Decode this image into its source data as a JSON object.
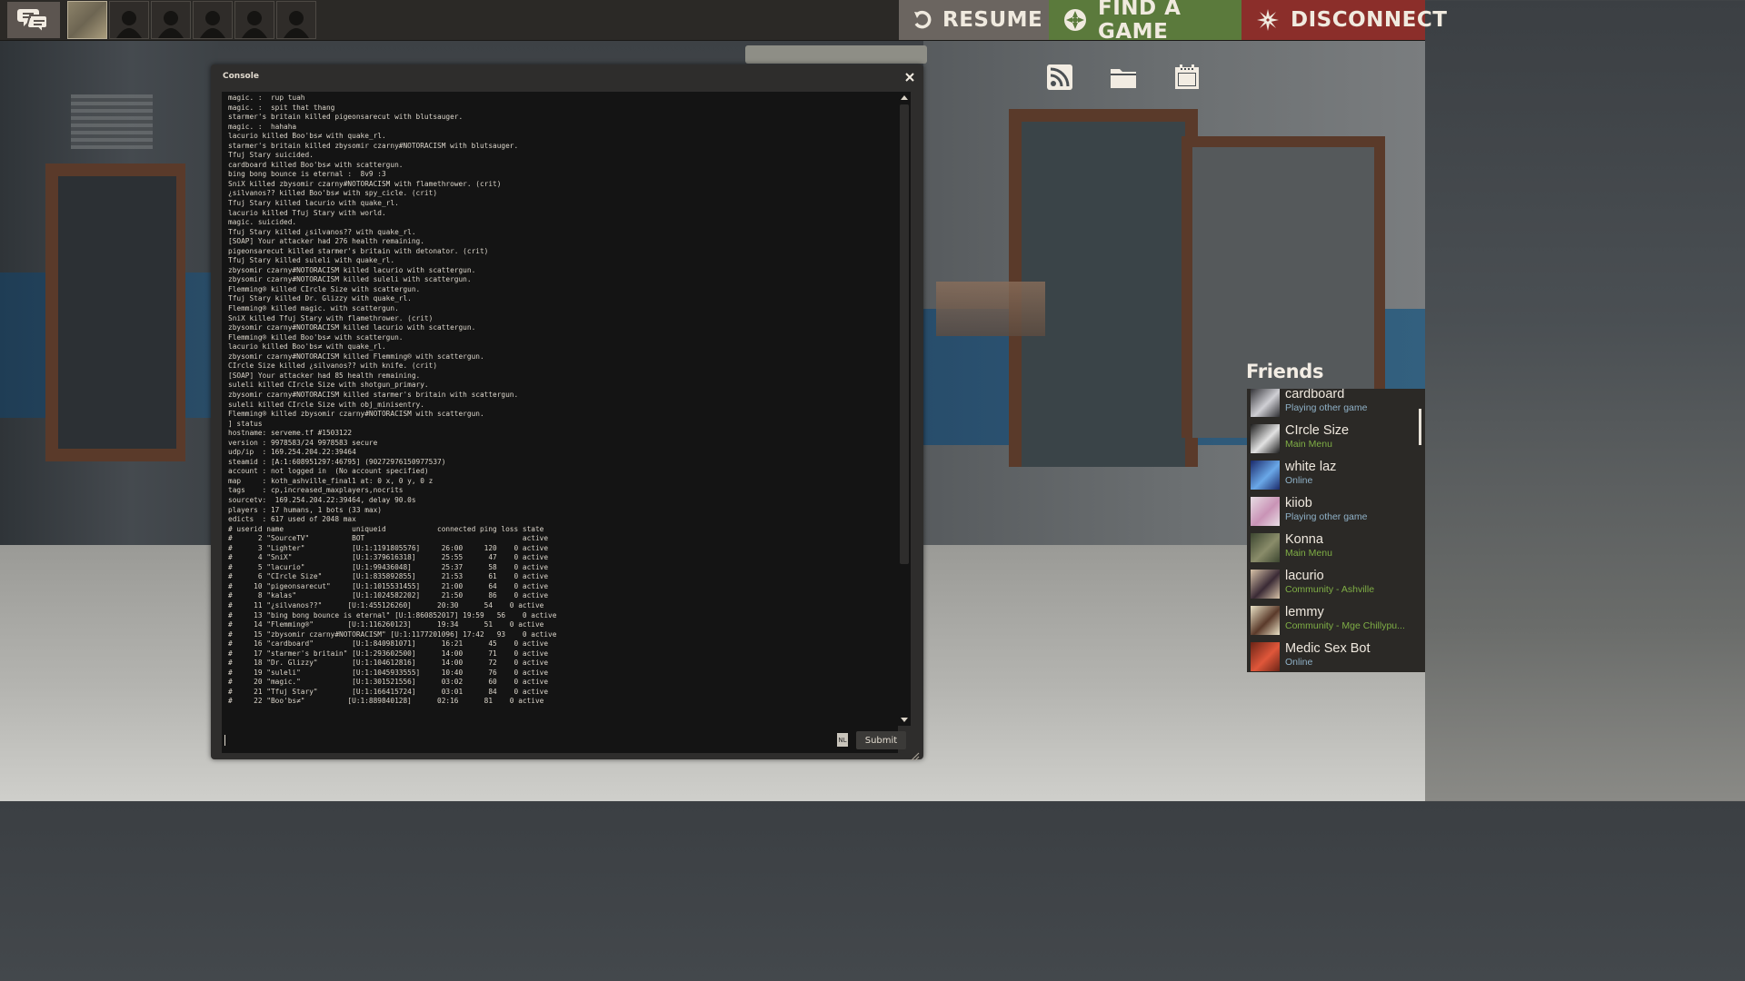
{
  "topbar": {
    "resume_label": "RESUME",
    "find_label": "FIND A GAME",
    "disconnect_label": "DISCONNECT",
    "icons": [
      "chat-icon",
      "resume-icon",
      "find-game-icon",
      "disconnect-icon"
    ]
  },
  "right_icons": [
    "rss-icon",
    "folder-icon",
    "calendar-icon"
  ],
  "console": {
    "title": "Console",
    "input_value": "",
    "nl_label": "NL",
    "submit_label": "Submit",
    "lines": [
      "magic. :  rup tuah",
      "magic. :  spit that thang",
      "starmer's britain killed pigeonsarecut with blutsauger.",
      "magic. :  hahaha",
      "lacurio killed Boo'bs≠ with quake_rl.",
      "starmer's britain killed zbysomir czarny#NOTORACISM with blutsauger.",
      "Tfuj Stary suicided.",
      "cardboard killed Boo'bs≠ with scattergun.",
      "bing bong bounce is eternal :  8v9 :3",
      "SniX killed zbysomir czarny#NOTORACISM with flamethrower. (crit)",
      "¿silvanos?? killed Boo'bs≠ with spy_cicle. (crit)",
      "Tfuj Stary killed lacurio with quake_rl.",
      "lacurio killed Tfuj Stary with world.",
      "magic. suicided.",
      "Tfuj Stary killed ¿silvanos?? with quake_rl.",
      "[SOAP] Your attacker had 276 health remaining.",
      "pigeonsarecut killed starmer's britain with detonator. (crit)",
      "Tfuj Stary killed suleli with quake_rl.",
      "zbysomir czarny#NOTORACISM killed lacurio with scattergun.",
      "zbysomir czarny#NOTORACISM killed suleli with scattergun.",
      "Flemming® killed CIrcle Size with scattergun.",
      "Tfuj Stary killed Dr. Glizzy with quake_rl.",
      "Flemming® killed magic. with scattergun.",
      "SniX killed Tfuj Stary with flamethrower. (crit)",
      "zbysomir czarny#NOTORACISM killed lacurio with scattergun.",
      "Flemming® killed Boo'bs≠ with scattergun.",
      "lacurio killed Boo'bs≠ with quake_rl.",
      "zbysomir czarny#NOTORACISM killed Flemming® with scattergun.",
      "CIrcle Size killed ¿silvanos?? with knife. (crit)",
      "[SOAP] Your attacker had 85 health remaining.",
      "suleli killed CIrcle Size with shotgun_primary.",
      "zbysomir czarny#NOTORACISM killed starmer's britain with scattergun.",
      "suleli killed CIrcle Size with obj_minisentry.",
      "Flemming® killed zbysomir czarny#NOTORACISM with scattergun.",
      "] status",
      "hostname: serveme.tf #1503122",
      "version : 9978583/24 9978583 secure",
      "udp/ip  : 169.254.204.22:39464",
      "steamid : [A:1:608951297:46795] (90272976150977537)",
      "account : not logged in  (No account specified)",
      "map     : koth_ashville_final1 at: 0 x, 0 y, 0 z",
      "tags    : cp,increased_maxplayers,nocrits",
      "sourcetv:  169.254.204.22:39464, delay 90.0s",
      "players : 17 humans, 1 bots (33 max)",
      "edicts  : 617 used of 2048 max",
      "# userid name                uniqueid            connected ping loss state",
      "#      2 \"SourceTV\"          BOT                                     active",
      "#      3 \"Lighter\"           [U:1:1191805576]     26:00     120    0 active",
      "#      4 \"SniX\"              [U:1:379616318]      25:55      47    0 active",
      "#      5 \"lacurio\"           [U:1:99436048]       25:37      58    0 active",
      "#      6 \"CIrcle Size\"       [U:1:835892855]      21:53      61    0 active",
      "#     10 \"pigeonsarecut\"     [U:1:1015531455]     21:00      64    0 active",
      "#      8 \"kalas\"             [U:1:1024582202]     21:50      86    0 active",
      "#     11 \"¿silvanos??\"      [U:1:455126260]      20:30      54    0 active",
      "#     13 \"bing bong bounce is eternal\" [U:1:860852017] 19:59   56    0 active",
      "#     14 \"Flemming®\"        [U:1:116260123]      19:34      51    0 active",
      "#     15 \"zbysomir czarny#NOTORACISM\" [U:1:1177201096] 17:42   93    0 active",
      "#     16 \"cardboard\"         [U:1:840981071]      16:21      45    0 active",
      "#     17 \"starmer's britain\" [U:1:293602500]      14:00      71    0 active",
      "#     18 \"Dr. Glizzy\"        [U:1:104612816]      14:00      72    0 active",
      "#     19 \"suleli\"            [U:1:1045933555]     10:40      76    0 active",
      "#     20 \"magic.\"            [U:1:301521556]      03:02      60    0 active",
      "#     21 \"Tfuj Stary\"        [U:1:166415724]      03:01      84    0 active",
      "#     22 \"Boo'bs≠\"          [U:1:889840128]      02:16      81    0 active"
    ]
  },
  "friends": {
    "title": "Friends",
    "list": [
      {
        "name": "cardboard",
        "status": "Playing other game",
        "status_color": "#8fb1c7",
        "avatar": [
          "#2f2f33",
          "#cfcfd4"
        ]
      },
      {
        "name": "CIrcle Size",
        "status": "Main Menu",
        "status_color": "#7fae45",
        "avatar": [
          "#1d1d1d",
          "#e2e2e2"
        ]
      },
      {
        "name": "white laz",
        "status": "Online",
        "status_color": "#8fb1c7",
        "avatar": [
          "#1b2a6b",
          "#6aa8e8"
        ]
      },
      {
        "name": "kiiob",
        "status": "Playing other game",
        "status_color": "#8fb1c7",
        "avatar": [
          "#e8dde4",
          "#c993b6"
        ]
      },
      {
        "name": "Konna",
        "status": "Main Menu",
        "status_color": "#7fae45",
        "avatar": [
          "#3c4630",
          "#8a8c6a"
        ]
      },
      {
        "name": "lacurio",
        "status": "Community - Ashville",
        "status_color": "#7fae45",
        "avatar": [
          "#d8c3a8",
          "#3a2a35"
        ]
      },
      {
        "name": "lemmy",
        "status": "Community - Mge Chillypu...",
        "status_color": "#7fae45",
        "avatar": [
          "#eae2c6",
          "#5a3a2a"
        ]
      },
      {
        "name": "Medic Sex Bot",
        "status": "Online",
        "status_color": "#8fb1c7",
        "avatar": [
          "#6b2416",
          "#e0573a"
        ]
      }
    ]
  }
}
